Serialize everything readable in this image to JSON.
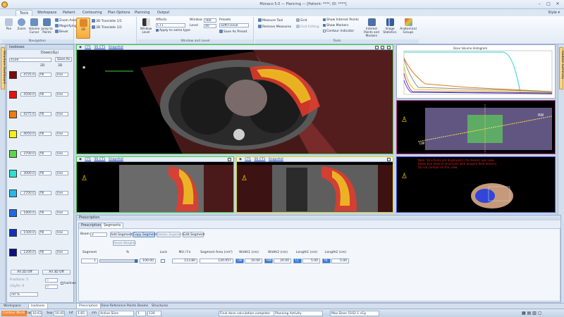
{
  "window": {
    "title": "Monaco 5.0 — Planning — [Patient: ****, ID: ****]",
    "controls": [
      "–",
      "□",
      "✕"
    ]
  },
  "tabs": [
    "Tools",
    "Workspace",
    "Patient",
    "Contouring",
    "Plan Options",
    "Planning",
    "Output"
  ],
  "style_label": "Style ▾",
  "ribbon": {
    "navigation": {
      "caption": "Navigation",
      "pan": "Pan",
      "zoom": "Zoom",
      "volume_cursor": "Volume Cursor",
      "jump_to_point": "Jump to Points",
      "zoom_area": "Zoom Area",
      "magnifying_glass": "Magnifying Glass",
      "bevel": "Bevel"
    },
    "translate": {
      "pt": "3D",
      "translate_1": "3D Translate 1/1",
      "translate_2": "3D Translate 1/2"
    },
    "wl": {
      "caption": "Window and Level",
      "window_level": "Window Level",
      "affects": "Affects",
      "affects_value": "CT1",
      "apply": "Apply to same type",
      "window_label": "Window",
      "window_value": "560",
      "level_label": "Level",
      "level_value": "40",
      "presets_label": "Presets",
      "presets_value": "Soft/Tissue",
      "save_preset": "Save As Preset"
    },
    "tools": {
      "caption": "Tools",
      "measure": "Measure Tool",
      "remove": "Remove Measures",
      "grid": "Grid",
      "grid_edit": "Grid Editing",
      "show_interest": "Show Interest Points",
      "show_markers": "Show Markers",
      "contour": "Contour Indicator",
      "interest_points": "Interest Points and Markers",
      "image_stats": "Image Statistics",
      "anat_groups": "Anatomical Groups"
    }
  },
  "left_strip": "Structure Dashboard",
  "right_strip": "Isodose Summary",
  "isodoses": {
    "title": "Isodoses",
    "header_label": "Dose(cGy)",
    "preset": "4500",
    "save_as": "Save As",
    "col_2d": "2D",
    "col_3d": "3D",
    "rows": [
      {
        "value": "4725.0",
        "o1": "fill",
        "o2": "line",
        "color": "#7a0b0b"
      },
      {
        "value": "4500.0",
        "o1": "fill",
        "o2": "line",
        "color": "#e81111"
      },
      {
        "value": "4275.0",
        "o1": "fill",
        "o2": "line",
        "color": "#ee7a12"
      },
      {
        "value": "4050.0",
        "o1": "fill",
        "o2": "line",
        "color": "#f6ef12"
      },
      {
        "value": "3700.0",
        "o1": "fill",
        "o2": "line",
        "color": "#5fd64a"
      },
      {
        "value": "3000.0",
        "o1": "fill",
        "o2": "line",
        "color": "#2ee0d0"
      },
      {
        "value": "2700.0",
        "o1": "fill",
        "o2": "line",
        "color": "#28b8e8"
      },
      {
        "value": "1800.0",
        "o1": "fill",
        "o2": "line",
        "color": "#1f6be0"
      },
      {
        "value": "1500.0",
        "o1": "fill",
        "o2": "line",
        "color": "#1530b8"
      },
      {
        "value": "1200.0",
        "o1": "fill",
        "o2": "line",
        "color": "#101080"
      }
    ],
    "all_2d_off": "All 2D Off",
    "all_3d_off": "All 3D Off",
    "fractions_label": "Fractions: 5",
    "fractions_value": "5",
    "cgy_label": "cGy/fx: 0",
    "cgy_value": "0",
    "isolines": "Isolines",
    "ref": "ref %"
  },
  "panes": {
    "main": {
      "slice": "CT1",
      "other": "SS CT1",
      "tag": "Snapshot"
    },
    "sag": {
      "slice": "CT1",
      "other": "SS CT1",
      "tag": "Snapshot"
    },
    "cor": {
      "slice": "CT1",
      "other": "SS CT1",
      "tag": "Snapshot"
    }
  },
  "dvh": {
    "title": "Dose Volume Histogram"
  },
  "red_notes": [
    "Note: Structures are displayed in the beams eye view.",
    "Beam Eye View of structures with tangent field delivery",
    "Do not contour on this view."
  ],
  "prescription": {
    "title": "Prescription",
    "tabs": [
      "Prescription",
      "Segments"
    ],
    "beam_label": "Beam",
    "beam_value": "2",
    "buttons": [
      "Add Segment",
      "Copy Segment",
      "Delete Segment",
      "Edit Segment"
    ],
    "reset_weights": "Reset Weights",
    "columns": [
      "Segment",
      "%",
      "Lock",
      "MU / Fx",
      "Segment Area (cm²)",
      "Width1 (cm)",
      "Width2 (cm)",
      "Length1 (cm)",
      "Length2 (cm)"
    ],
    "row": {
      "segment": "1",
      "percent": "100.00",
      "mu": "113.80",
      "area": "120.057",
      "w1_dir": "LW",
      "w1": "20.00",
      "w2_dir": "RW",
      "w2": "20.00",
      "l1_dir": "LL",
      "l1": "5.00",
      "l2_dir": "RL",
      "l2": "5.00"
    }
  },
  "bottom_tabs": [
    "Workspace",
    "Isodoses",
    "Prescription",
    "Dose Reference Points",
    "Beams",
    "Structures"
  ],
  "status": {
    "mode": "Contour Mode",
    "cap": "Cap",
    "cap_value": "10.63",
    "sup": "Sup",
    "sup_value": "10.45",
    "inf": "Inf",
    "inf_value": "1.65",
    "unit": "cm",
    "active": "Active Slice",
    "slice_value": "1",
    "slice_num": "130",
    "calc": "Final dose calculation complete",
    "activity": "Planning Activity",
    "maxdose": "Max Dose 5102.1 cGy"
  }
}
